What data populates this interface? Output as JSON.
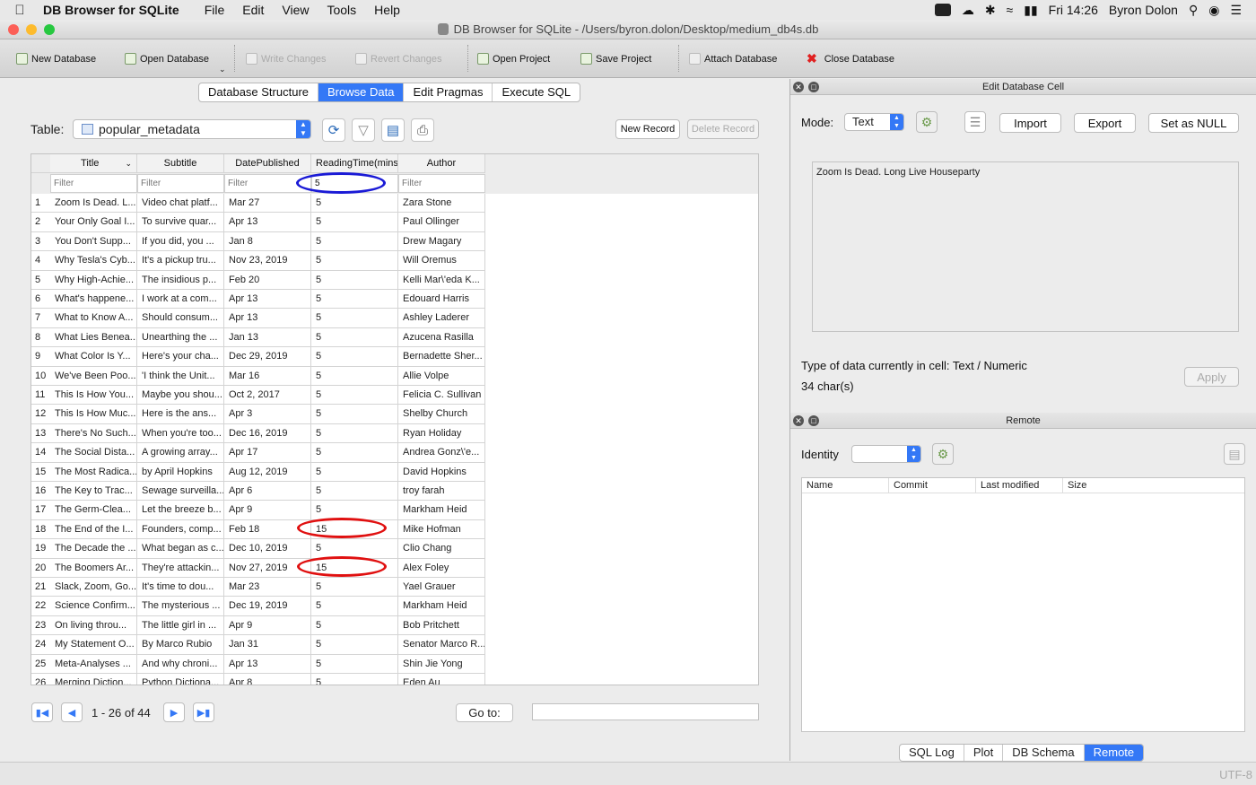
{
  "menubar": {
    "app_name": "DB Browser for SQLite",
    "menus": [
      "File",
      "Edit",
      "View",
      "Tools",
      "Help"
    ],
    "clock": "Fri 14:26",
    "user": "Byron Dolon"
  },
  "window": {
    "title": "DB Browser for SQLite - /Users/byron.dolon/Desktop/medium_db4s.db"
  },
  "toolbar": {
    "new_database": "New Database",
    "open_database": "Open Database",
    "write_changes": "Write Changes",
    "revert_changes": "Revert Changes",
    "open_project": "Open Project",
    "save_project": "Save Project",
    "attach_database": "Attach Database",
    "close_database": "Close Database"
  },
  "tabs": [
    "Database Structure",
    "Browse Data",
    "Edit Pragmas",
    "Execute SQL"
  ],
  "browse": {
    "table_label": "Table:",
    "table_name": "popular_metadata",
    "new_record": "New Record",
    "delete_record": "Delete Record",
    "columns": [
      "Title",
      "Subtitle",
      "DatePublished",
      "ReadingTime(mins)",
      "Author"
    ],
    "filter_placeholder": "Filter",
    "filter_values": [
      "",
      "",
      "",
      "5",
      ""
    ],
    "rows": [
      [
        "1",
        "Zoom Is Dead. L...",
        "Video chat platf...",
        "Mar 27",
        "5",
        "Zara Stone"
      ],
      [
        "2",
        "Your Only Goal I...",
        "To survive quar...",
        "Apr 13",
        "5",
        "Paul Ollinger"
      ],
      [
        "3",
        "You Don't Supp...",
        "If you did, you ...",
        "Jan 8",
        "5",
        "Drew Magary"
      ],
      [
        "4",
        "Why Tesla's Cyb...",
        "It's a pickup tru...",
        "Nov 23, 2019",
        "5",
        "Will Oremus"
      ],
      [
        "5",
        "Why High-Achie...",
        "The insidious p...",
        "Feb 20",
        "5",
        "Kelli Mar\\'eda K..."
      ],
      [
        "6",
        "What's happene...",
        "I work at a com...",
        "Apr 13",
        "5",
        "Edouard Harris"
      ],
      [
        "7",
        "What to Know A...",
        "Should consum...",
        "Apr 13",
        "5",
        "Ashley Laderer"
      ],
      [
        "8",
        "What Lies Benea...",
        "Unearthing the ...",
        "Jan 13",
        "5",
        "Azucena Rasilla"
      ],
      [
        "9",
        "What Color Is Y...",
        "Here's your cha...",
        "Dec 29, 2019",
        "5",
        "Bernadette Sher..."
      ],
      [
        "10",
        "We've Been Poo...",
        "'I think the Unit...",
        "Mar 16",
        "5",
        "Allie Volpe"
      ],
      [
        "11",
        "This Is How You...",
        "Maybe you shou...",
        "Oct 2, 2017",
        "5",
        "Felicia C. Sullivan"
      ],
      [
        "12",
        "This Is How Muc...",
        "Here is the ans...",
        "Apr 3",
        "5",
        "Shelby Church"
      ],
      [
        "13",
        "There's No Such...",
        "When you're too...",
        "Dec 16, 2019",
        "5",
        "Ryan Holiday"
      ],
      [
        "14",
        "The Social Dista...",
        "A growing array...",
        "Apr 17",
        "5",
        "Andrea Gonz\\'e..."
      ],
      [
        "15",
        "The Most Radica...",
        "by April Hopkins",
        "Aug 12, 2019",
        "5",
        "David Hopkins"
      ],
      [
        "16",
        "The Key to Trac...",
        "Sewage surveilla...",
        "Apr 6",
        "5",
        "troy farah"
      ],
      [
        "17",
        "The Germ-Clea...",
        "Let the breeze b...",
        "Apr 9",
        "5",
        "Markham Heid"
      ],
      [
        "18",
        "The End of the I...",
        "Founders, comp...",
        "Feb 18",
        "15",
        "Mike Hofman"
      ],
      [
        "19",
        "The Decade the ...",
        "What began as c...",
        "Dec 10, 2019",
        "5",
        "Clio Chang"
      ],
      [
        "20",
        "The Boomers Ar...",
        "They're attackin...",
        "Nov 27, 2019",
        "15",
        "Alex Foley"
      ],
      [
        "21",
        "Slack, Zoom, Go...",
        "It's time to dou...",
        "Mar 23",
        "5",
        "Yael Grauer"
      ],
      [
        "22",
        "Science Confirm...",
        "The mysterious ...",
        "Dec 19, 2019",
        "5",
        "Markham Heid"
      ],
      [
        "23",
        "On living throu...",
        "The little girl in ...",
        "Apr 9",
        "5",
        "Bob Pritchett"
      ],
      [
        "24",
        "My Statement O...",
        "By Marco Rubio",
        "Jan 31",
        "5",
        "Senator Marco R..."
      ],
      [
        "25",
        "Meta-Analyses ...",
        "And why chroni...",
        "Apr 13",
        "5",
        "Shin Jie Yong"
      ],
      [
        "26",
        "Merging Diction...",
        "Python Dictiona...",
        "Apr 8",
        "5",
        "Eden Au"
      ]
    ],
    "pager_text": "1 - 26 of 44",
    "goto_label": "Go to:"
  },
  "edit_cell": {
    "title": "Edit Database Cell",
    "mode_label": "Mode:",
    "mode_value": "Text",
    "import": "Import",
    "export": "Export",
    "set_null": "Set as NULL",
    "content": "Zoom Is Dead. Long Live Houseparty",
    "type_info": "Type of data currently in cell: Text / Numeric",
    "char_count": "34 char(s)",
    "apply": "Apply"
  },
  "remote": {
    "title": "Remote",
    "identity_label": "Identity",
    "columns": [
      "Name",
      "Commit",
      "Last modified",
      "Size"
    ]
  },
  "bottom_tabs": [
    "SQL Log",
    "Plot",
    "DB Schema",
    "Remote"
  ],
  "status": {
    "encoding": "UTF-8"
  },
  "colors": {
    "accent": "#3478f6",
    "highlight_blue": "#1a1ad6",
    "highlight_red": "#e01010"
  }
}
